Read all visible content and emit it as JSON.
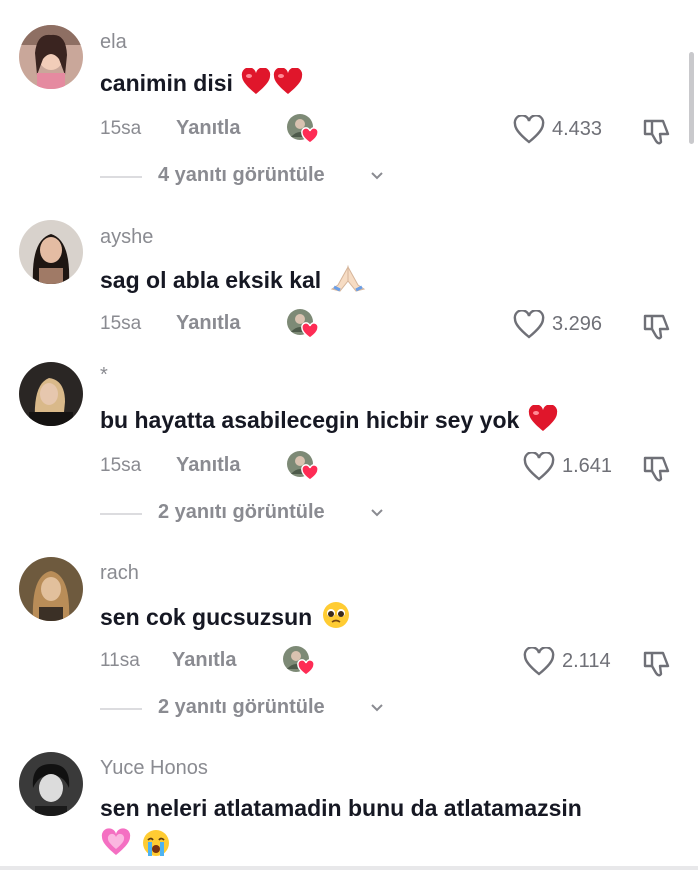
{
  "comments": [
    {
      "username": "ela",
      "text": "canimin disi",
      "emojis": [
        "red-heart",
        "red-heart"
      ],
      "time": "15sa",
      "reply_label": "Yanıtla",
      "likes": "4.433",
      "view_replies": "4 yanıtı görüntüle"
    },
    {
      "username": "ayshe",
      "text": "sag ol abla eksik kal",
      "emojis": [
        "praying-hands"
      ],
      "time": "15sa",
      "reply_label": "Yanıtla",
      "likes": "3.296",
      "view_replies": ""
    },
    {
      "username": "*",
      "text": "bu hayatta asabilecegin hicbir sey yok",
      "emojis": [
        "red-heart"
      ],
      "time": "15sa",
      "reply_label": "Yanıtla",
      "likes": "1.641",
      "view_replies": "2 yanıtı görüntüle"
    },
    {
      "username": "rach",
      "text": "sen cok gucsuzsun",
      "emojis": [
        "pleading-face"
      ],
      "time": "11sa",
      "reply_label": "Yanıtla",
      "likes": "2.114",
      "view_replies": "2 yanıtı görüntüle"
    },
    {
      "username": "Yuce Honos",
      "text": "sen neleri atlatamadin bunu da atlatamazsin",
      "emojis": [
        "pink-heart",
        "crying-face"
      ],
      "time": "",
      "reply_label": "",
      "likes": "",
      "view_replies": ""
    }
  ],
  "colors": {
    "text": "#161823",
    "muted": "#8a8b91",
    "heart": "#fe2c55"
  }
}
